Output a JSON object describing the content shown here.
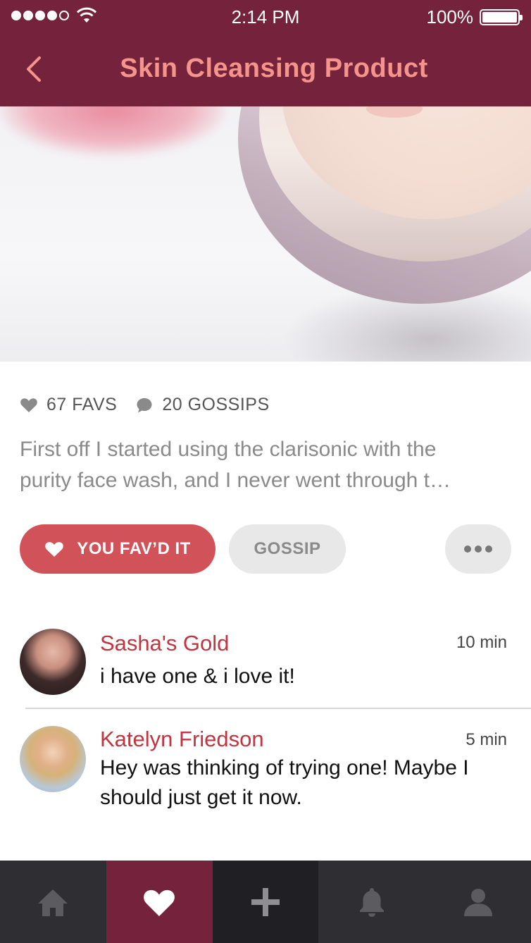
{
  "status_bar": {
    "time": "2:14 PM",
    "battery": "100%"
  },
  "header": {
    "title": "Skin Cleansing Product",
    "back_icon": "chevron-left-icon"
  },
  "post": {
    "favs": "67 FAVS",
    "gossips": "20 GOSSIPS",
    "excerpt_line1": "First off I started using the clarisonic with the",
    "excerpt_line2": "purity face wash, and I never went through t…"
  },
  "actions": {
    "fav_label": "YOU FAV’D IT",
    "gossip_label": "GOSSIP"
  },
  "comments": [
    {
      "author": "Sasha's Gold",
      "time": "10 min",
      "text": "i have one & i love it!"
    },
    {
      "author": "Katelyn Friedson",
      "time": "5 min",
      "text": "Hey was thinking of trying one! Maybe I should just get it now."
    }
  ],
  "tabbar": {
    "items": [
      "home-icon",
      "heart-icon",
      "plus-icon",
      "bell-icon",
      "person-icon"
    ],
    "active": "heart-icon"
  },
  "colors": {
    "brand": "#75233c",
    "title": "#f5948a",
    "accent": "#d25259",
    "author": "#c0353f"
  }
}
